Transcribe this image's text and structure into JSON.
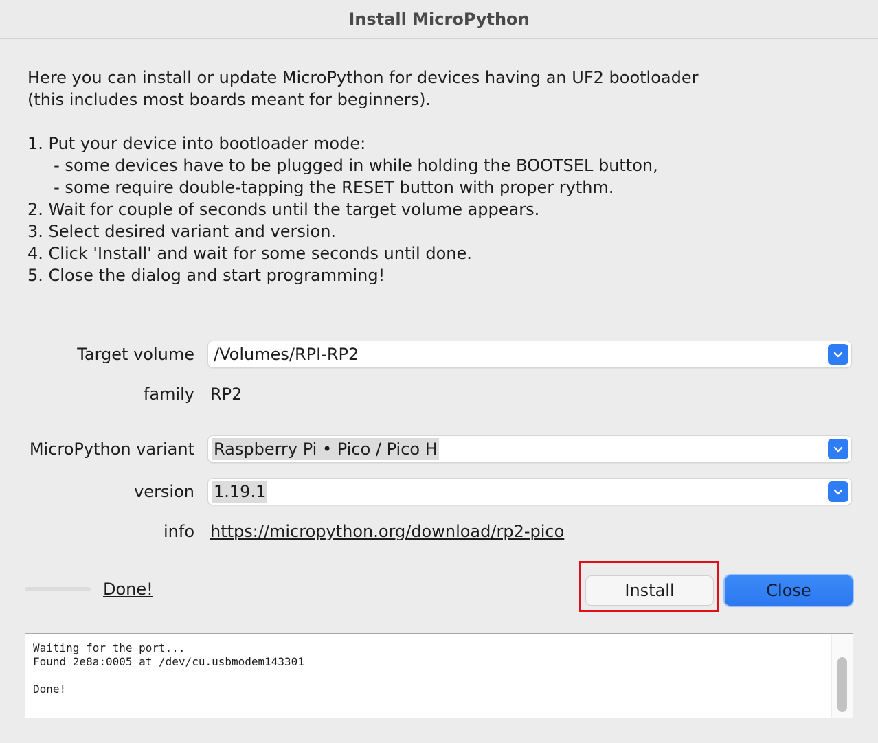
{
  "window": {
    "title": "Install MicroPython"
  },
  "intro": {
    "lines": [
      "Here you can install or update MicroPython for devices having an UF2 bootloader",
      "(this includes most boards meant for beginners).",
      "",
      "1. Put your device into bootloader mode:",
      "     - some devices have to be plugged in while holding the BOOTSEL button,",
      "     - some require double-tapping the RESET button with proper rythm.",
      "2. Wait for couple of seconds until the target volume appears.",
      "3. Select desired variant and version.",
      "4. Click 'Install' and wait for some seconds until done.",
      "5. Close the dialog and start programming!"
    ]
  },
  "form": {
    "target_volume_label": "Target volume",
    "target_volume_value": "/Volumes/RPI-RP2",
    "family_label": "family",
    "family_value": "RP2",
    "variant_label": "MicroPython variant",
    "variant_value": "Raspberry Pi • Pico / Pico H",
    "version_label": "version",
    "version_value": "1.19.1",
    "info_label": "info",
    "info_link": "https://micropython.org/download/rp2-pico"
  },
  "status": {
    "progress": 0,
    "done_label": "Done!"
  },
  "buttons": {
    "install_label": "Install",
    "close_label": "Close"
  },
  "log": {
    "lines": [
      "Waiting for the port...",
      "Found 2e8a:0005 at /dev/cu.usbmodem143301",
      "",
      "Done!"
    ]
  },
  "colors": {
    "accent": "#2f7df6",
    "highlight_border": "#e0101a",
    "window_bg": "#ececec"
  },
  "icons": {
    "combo_arrow": "chevron-down-icon"
  }
}
